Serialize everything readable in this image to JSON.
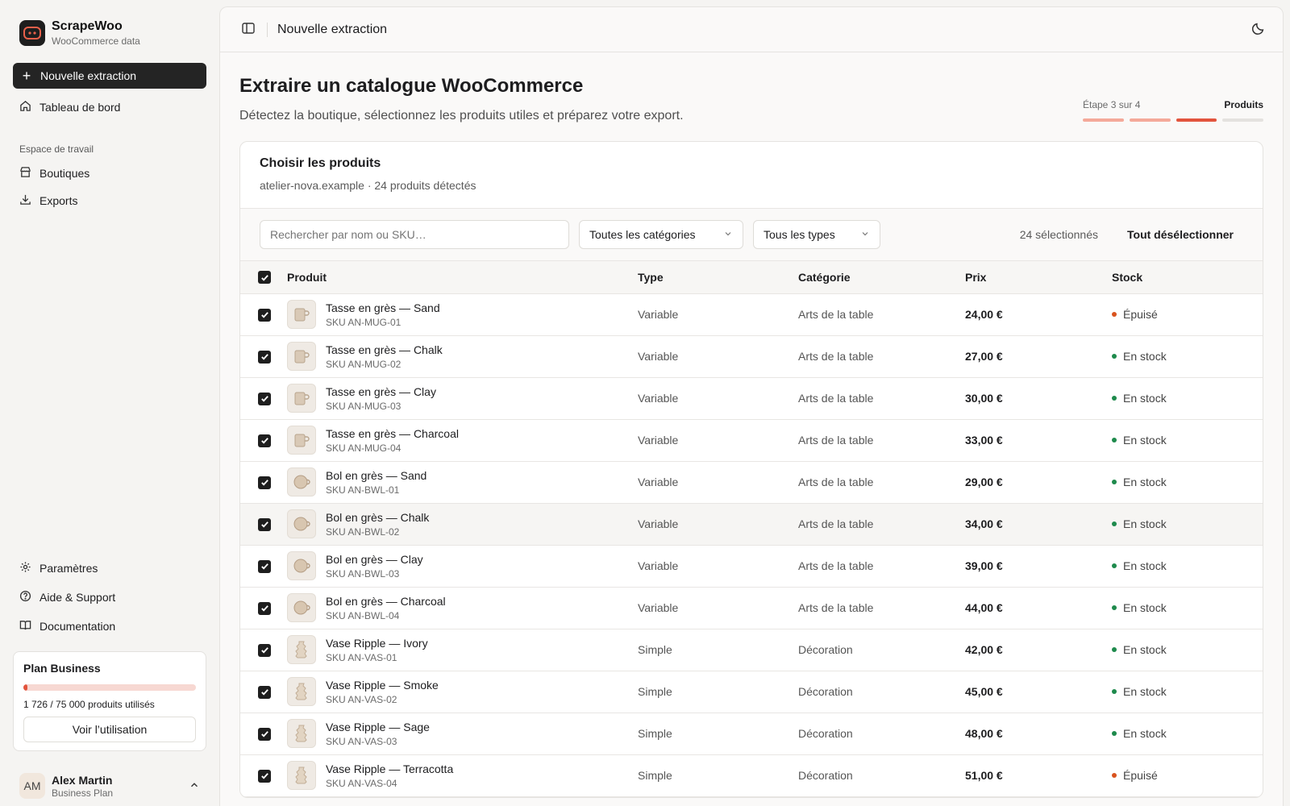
{
  "brand": {
    "name": "ScrapeWoo",
    "subtitle": "WooCommerce data"
  },
  "sidebar": {
    "new_button": "Nouvelle extraction",
    "dashboard": "Tableau de bord",
    "section_label": "Espace de travail",
    "workspace_items": [
      {
        "label": "Boutiques",
        "icon": "store-icon"
      },
      {
        "label": "Exports",
        "icon": "download-icon"
      }
    ],
    "bottom_items": [
      {
        "label": "Paramètres",
        "icon": "gear-icon"
      },
      {
        "label": "Aide & Support",
        "icon": "help-circle-icon"
      },
      {
        "label": "Documentation",
        "icon": "book-icon"
      }
    ]
  },
  "plan": {
    "title": "Plan Business",
    "usage_text": "1 726 / 75 000 produits utilisés",
    "usage_fraction": 0.023,
    "button": "Voir l’utilisation"
  },
  "user": {
    "initials": "AM",
    "name": "Alex Martin",
    "plan": "Business Plan"
  },
  "topbar": {
    "title": "Nouvelle extraction"
  },
  "page": {
    "title": "Extraire un catalogue WooCommerce",
    "subtitle": "Détectez la boutique, sélectionnez les produits utiles et préparez votre export."
  },
  "stepper": {
    "step_text": "Étape 3 sur 4",
    "step_name": "Produits",
    "current": 3,
    "total": 4
  },
  "card": {
    "title": "Choisir les produits",
    "subtitle": "atelier-nova.example · 24 produits détectés"
  },
  "toolbar": {
    "search_placeholder": "Rechercher par nom ou SKU…",
    "category_select": "Toutes les catégories",
    "type_select": "Tous les types",
    "selected_count": "24 sélectionnés",
    "deselect_all": "Tout désélectionner"
  },
  "table": {
    "columns": [
      "Produit",
      "Type",
      "Catégorie",
      "Prix",
      "Stock"
    ],
    "rows": [
      {
        "name": "Tasse en grès — Sand",
        "sku": "SKU AN-MUG-01",
        "type": "Variable",
        "category": "Arts de la table",
        "price": "24,00 €",
        "stock": "Épuisé",
        "stock_color": "#d9531e",
        "thumb": "mug"
      },
      {
        "name": "Tasse en grès — Chalk",
        "sku": "SKU AN-MUG-02",
        "type": "Variable",
        "category": "Arts de la table",
        "price": "27,00 €",
        "stock": "En stock",
        "stock_color": "#1e8a4c",
        "thumb": "mug"
      },
      {
        "name": "Tasse en grès — Clay",
        "sku": "SKU AN-MUG-03",
        "type": "Variable",
        "category": "Arts de la table",
        "price": "30,00 €",
        "stock": "En stock",
        "stock_color": "#1e8a4c",
        "thumb": "mug"
      },
      {
        "name": "Tasse en grès — Charcoal",
        "sku": "SKU AN-MUG-04",
        "type": "Variable",
        "category": "Arts de la table",
        "price": "33,00 €",
        "stock": "En stock",
        "stock_color": "#1e8a4c",
        "thumb": "mug"
      },
      {
        "name": "Bol en grès — Sand",
        "sku": "SKU AN-BWL-01",
        "type": "Variable",
        "category": "Arts de la table",
        "price": "29,00 €",
        "stock": "En stock",
        "stock_color": "#1e8a4c",
        "thumb": "bowl"
      },
      {
        "name": "Bol en grès — Chalk",
        "sku": "SKU AN-BWL-02",
        "type": "Variable",
        "category": "Arts de la table",
        "price": "34,00 €",
        "stock": "En stock",
        "stock_color": "#1e8a4c",
        "thumb": "bowl"
      },
      {
        "name": "Bol en grès — Clay",
        "sku": "SKU AN-BWL-03",
        "type": "Variable",
        "category": "Arts de la table",
        "price": "39,00 €",
        "stock": "En stock",
        "stock_color": "#1e8a4c",
        "thumb": "bowl"
      },
      {
        "name": "Bol en grès — Charcoal",
        "sku": "SKU AN-BWL-04",
        "type": "Variable",
        "category": "Arts de la table",
        "price": "44,00 €",
        "stock": "En stock",
        "stock_color": "#1e8a4c",
        "thumb": "bowl"
      },
      {
        "name": "Vase Ripple — Ivory",
        "sku": "SKU AN-VAS-01",
        "type": "Simple",
        "category": "Décoration",
        "price": "42,00 €",
        "stock": "En stock",
        "stock_color": "#1e8a4c",
        "thumb": "vase"
      },
      {
        "name": "Vase Ripple — Smoke",
        "sku": "SKU AN-VAS-02",
        "type": "Simple",
        "category": "Décoration",
        "price": "45,00 €",
        "stock": "En stock",
        "stock_color": "#1e8a4c",
        "thumb": "vase"
      },
      {
        "name": "Vase Ripple — Sage",
        "sku": "SKU AN-VAS-03",
        "type": "Simple",
        "category": "Décoration",
        "price": "48,00 €",
        "stock": "En stock",
        "stock_color": "#1e8a4c",
        "thumb": "vase"
      },
      {
        "name": "Vase Ripple — Terracotta",
        "sku": "SKU AN-VAS-04",
        "type": "Simple",
        "category": "Décoration",
        "price": "51,00 €",
        "stock": "Épuisé",
        "stock_color": "#d9531e",
        "thumb": "vase"
      }
    ]
  },
  "colors": {
    "accent": "#e2543d",
    "accent_light": "#f4a99a",
    "in_stock": "#1e8a4c",
    "out_of_stock": "#d9531e"
  }
}
